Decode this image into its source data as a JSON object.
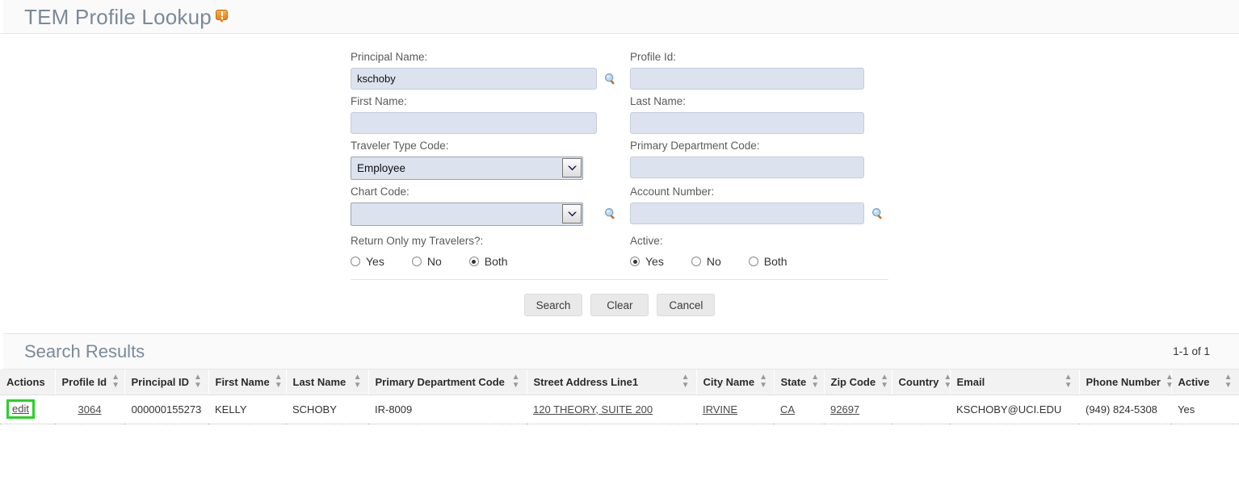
{
  "header": {
    "title": "TEM Profile Lookup",
    "help_icon": "help-bubble-icon"
  },
  "form": {
    "fields": {
      "principal_name": {
        "label": "Principal Name:",
        "value": "kschoby",
        "lookup_icon": "magnifier-icon"
      },
      "profile_id": {
        "label": "Profile Id:",
        "value": ""
      },
      "first_name": {
        "label": "First Name:",
        "value": ""
      },
      "last_name": {
        "label": "Last Name:",
        "value": ""
      },
      "traveler_type_code": {
        "label": "Traveler Type Code:",
        "value": "Employee",
        "options": [
          "Employee"
        ]
      },
      "primary_department_code": {
        "label": "Primary Department Code:",
        "value": ""
      },
      "chart_code": {
        "label": "Chart Code:",
        "value": "",
        "options": [
          ""
        ],
        "lookup_icon": "magnifier-icon"
      },
      "account_number": {
        "label": "Account Number:",
        "value": "",
        "lookup_icon": "magnifier-icon"
      }
    },
    "radios": {
      "return_only_my_travelers": {
        "label": "Return Only my Travelers?:",
        "options": [
          "Yes",
          "No",
          "Both"
        ],
        "selected": "Both"
      },
      "active": {
        "label": "Active:",
        "options": [
          "Yes",
          "No",
          "Both"
        ],
        "selected": "Yes"
      }
    },
    "buttons": {
      "search": "Search",
      "clear": "Clear",
      "cancel": "Cancel"
    }
  },
  "results": {
    "title": "Search Results",
    "count": "1-1 of 1",
    "columns": [
      {
        "label": "Actions",
        "sortable": false
      },
      {
        "label": "Profile Id",
        "sortable": true
      },
      {
        "label": "Principal ID",
        "sortable": true
      },
      {
        "label": "First Name",
        "sortable": true
      },
      {
        "label": "Last Name",
        "sortable": true
      },
      {
        "label": "Primary Department Code",
        "sortable": true
      },
      {
        "label": "Street Address Line1",
        "sortable": true
      },
      {
        "label": "City Name",
        "sortable": true
      },
      {
        "label": "State",
        "sortable": true
      },
      {
        "label": "Zip Code",
        "sortable": true
      },
      {
        "label": "Country",
        "sortable": true
      },
      {
        "label": "Email",
        "sortable": true
      },
      {
        "label": "Phone Number",
        "sortable": true
      },
      {
        "label": "Active",
        "sortable": true
      }
    ],
    "rows": [
      {
        "action": "edit",
        "profile_id": "3064",
        "principal_id": "000000155273",
        "first_name": "KELLY",
        "last_name": "SCHOBY",
        "primary_department_code": "IR-8009",
        "street_address_line1": "120 THEORY, SUITE 200",
        "city_name": "IRVINE",
        "state": "CA",
        "zip_code": "92697",
        "country": "",
        "email": "KSCHOBY@UCI.EDU",
        "phone_number": "(949) 824-5308",
        "active": "Yes"
      }
    ]
  },
  "colors": {
    "title_text": "#7a8a99",
    "input_bg": "#dde2ef",
    "highlight_green": "#22d522",
    "help_orange": "#e8821e"
  }
}
